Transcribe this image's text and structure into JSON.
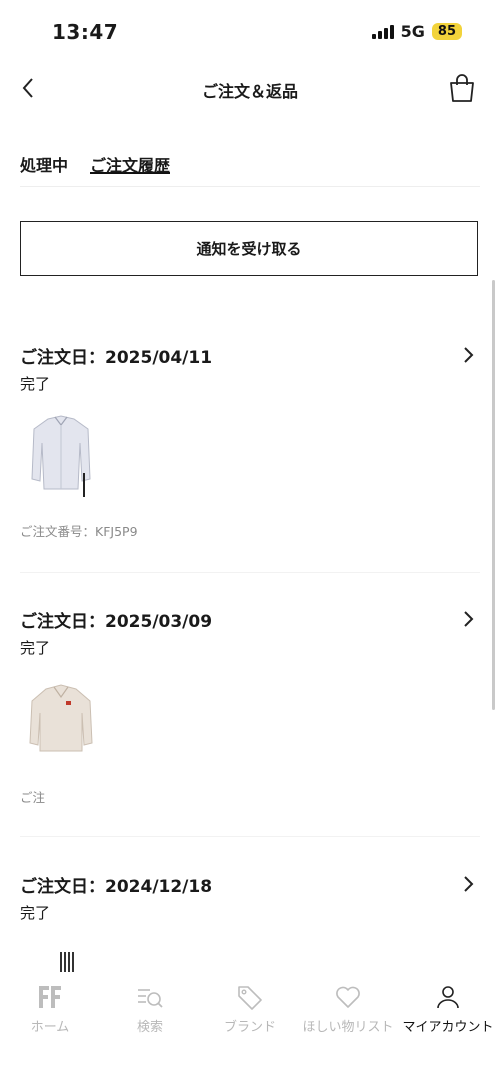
{
  "status_bar": {
    "time": "13:47",
    "network": "5G",
    "battery": "85"
  },
  "nav": {
    "title": "ご注文＆返品"
  },
  "tabs": [
    {
      "label": "処理中"
    },
    {
      "label": "ご注文履歴"
    }
  ],
  "notify_button": {
    "label": "通知を受け取る"
  },
  "orders": [
    {
      "date": "ご注文日：2025/04/11",
      "status": "完了",
      "order_number": "ご注文番号：KFJ5P9"
    },
    {
      "date": "ご注文日：2025/03/09",
      "status": "完了",
      "order_number": "ご注"
    },
    {
      "date": "ご注文日：2024/12/18",
      "status": "完了"
    }
  ],
  "bottom_nav": [
    {
      "label": "ホーム",
      "icon": "farfetch-logo-icon"
    },
    {
      "label": "検索",
      "icon": "search-icon"
    },
    {
      "label": "ブランド",
      "icon": "tag-icon"
    },
    {
      "label": "ほしい物リスト",
      "icon": "heart-icon"
    },
    {
      "label": "マイアカウント",
      "icon": "person-icon"
    }
  ],
  "colors": {
    "accent": "#111111",
    "battery": "#f2d33b",
    "inactive": "#b8b8b8"
  }
}
